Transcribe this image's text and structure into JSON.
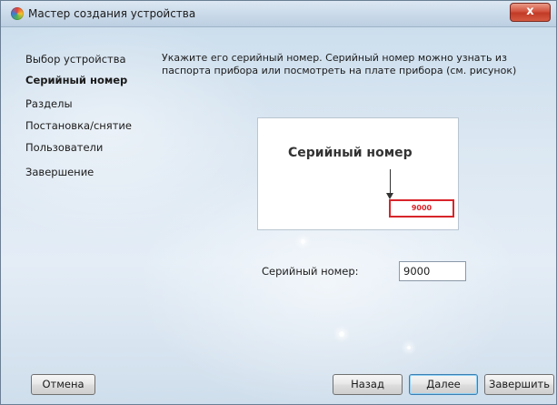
{
  "window": {
    "title": "Мастер создания устройства",
    "close_glyph": "x",
    "app_icon": "color-wheel-icon"
  },
  "steps": [
    {
      "label": "Выбор устройства",
      "active": false
    },
    {
      "label": "Серийный номер",
      "active": true
    },
    {
      "label": "Разделы",
      "active": false
    },
    {
      "label": "Постановка/снятие",
      "active": false
    },
    {
      "label": "Пользователи",
      "active": false
    },
    {
      "label": "Завершение",
      "active": false
    }
  ],
  "instruction": "Укажите его серийный номер. Серийный номер можно узнать из паспорта прибора или посмотреть на плате прибора (см. рисунок)",
  "figure": {
    "caption": "Серийный номер",
    "serial_sample": "9000",
    "highlight_color": "#d8252a"
  },
  "serial_field": {
    "label": "Серийный номер:",
    "value": "9000"
  },
  "buttons": {
    "cancel": "Отмена",
    "back": "Назад",
    "next": "Далее",
    "finish": "Завершить"
  }
}
